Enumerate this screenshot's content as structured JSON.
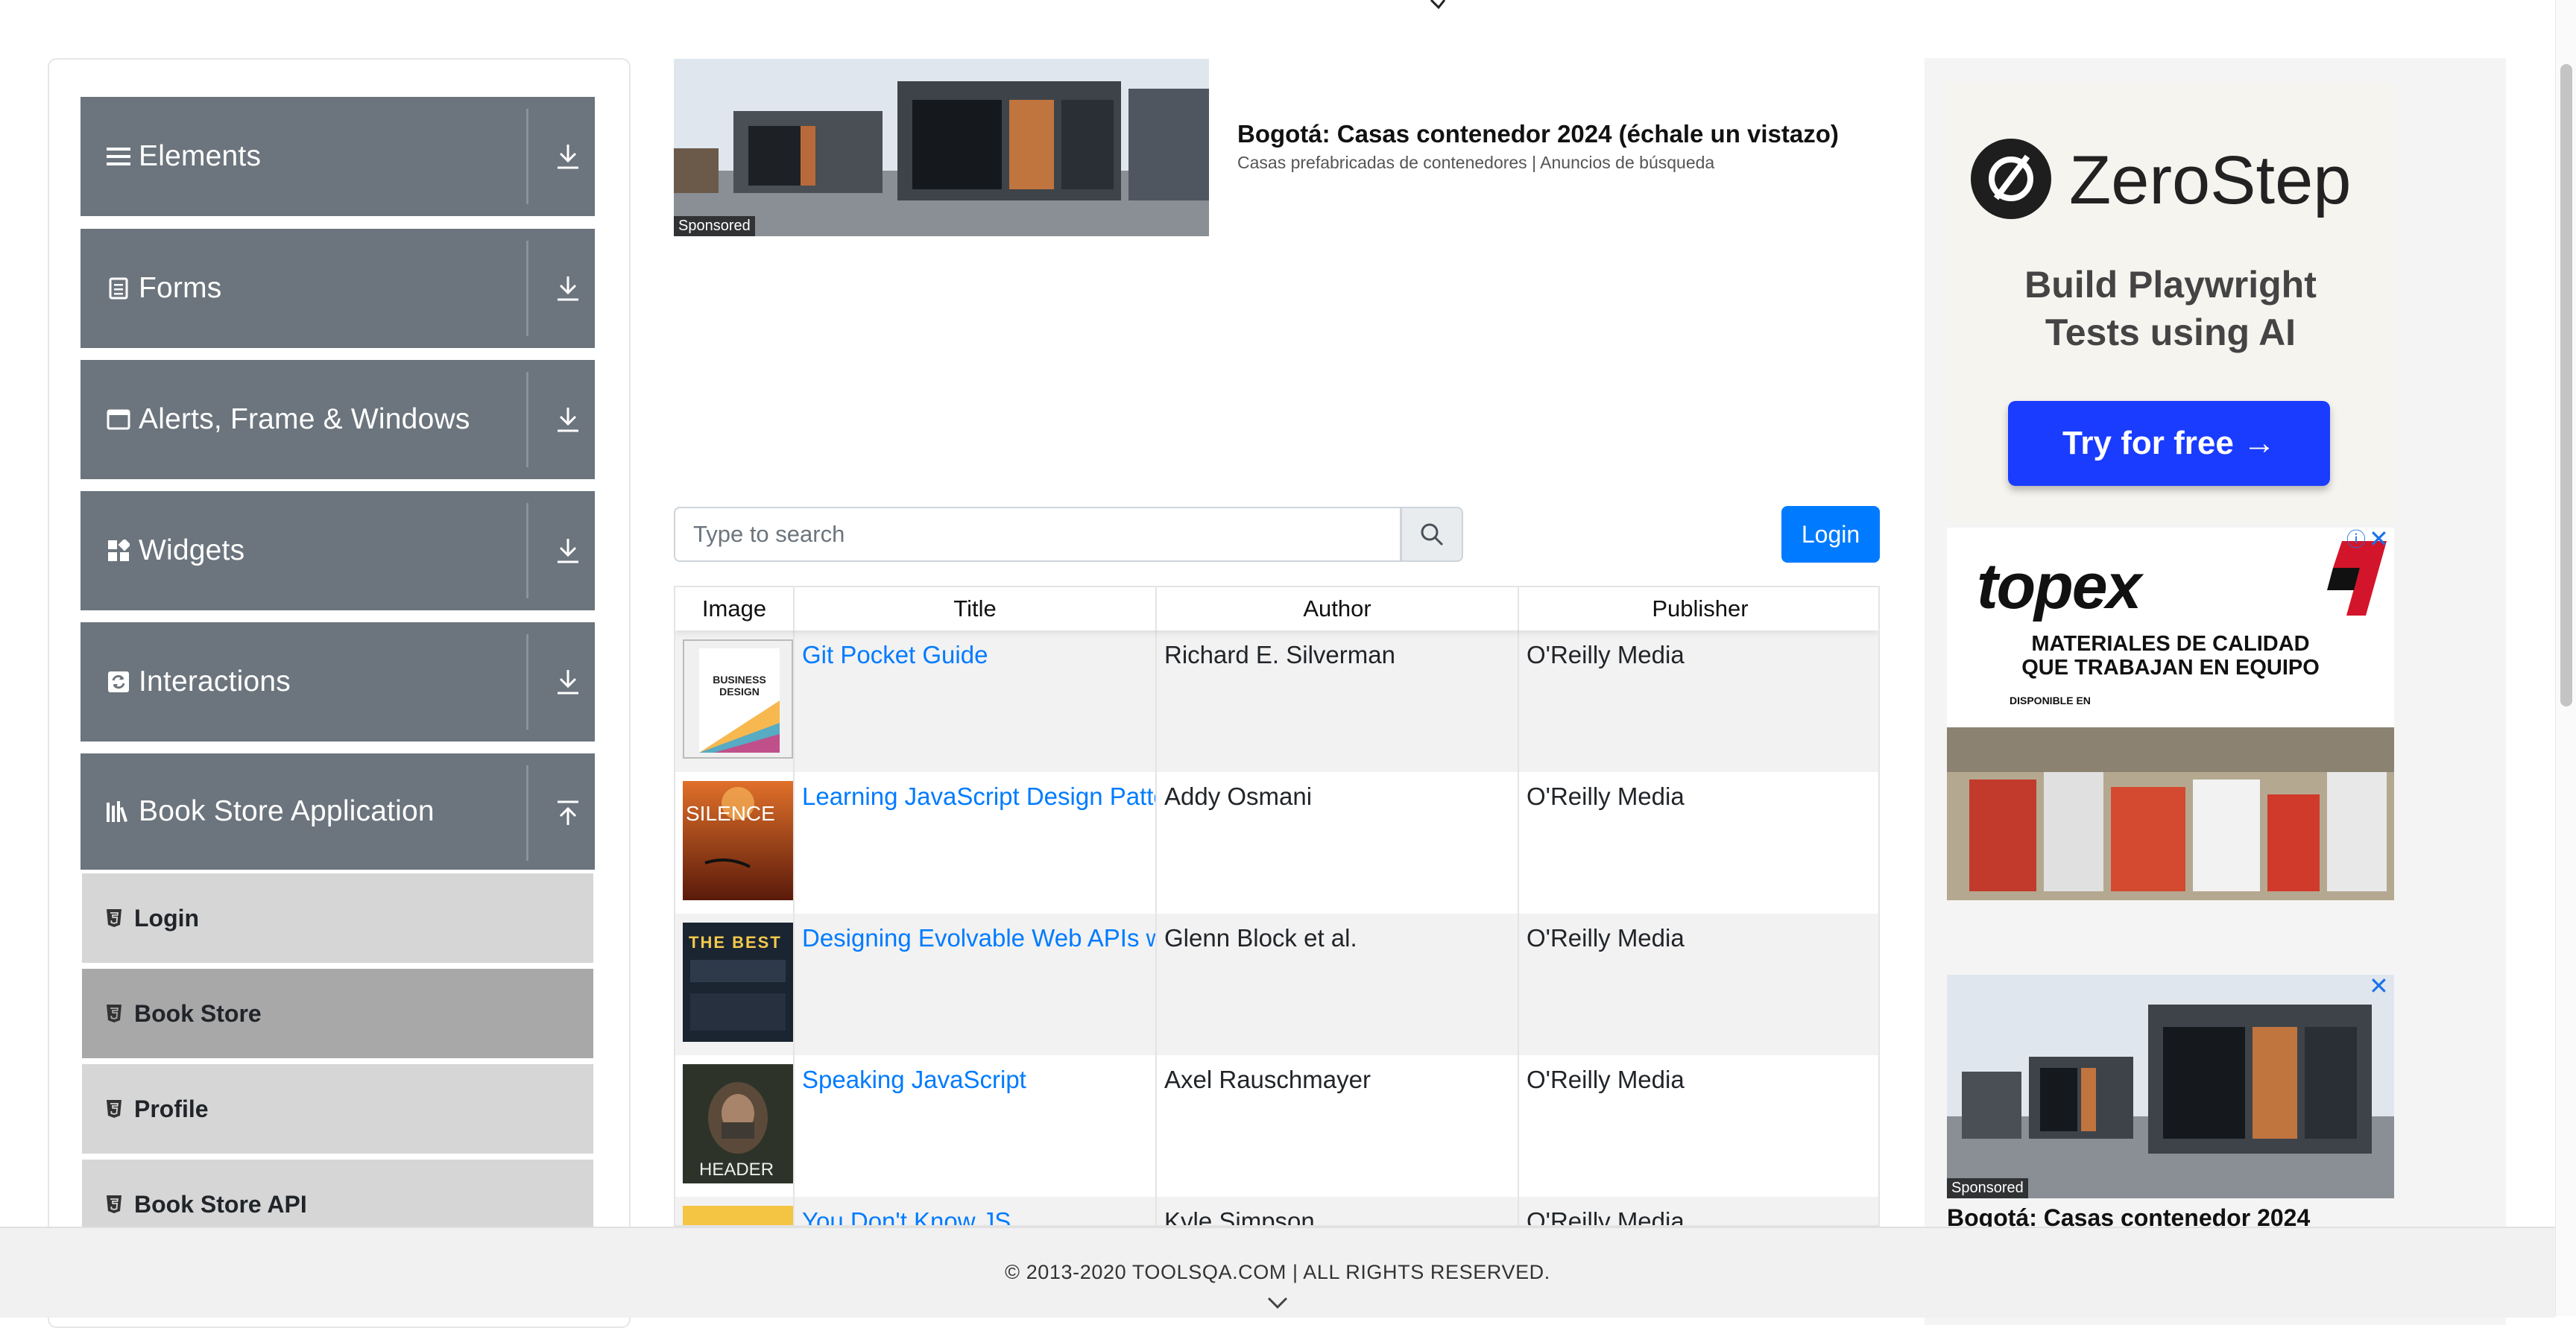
{
  "sidebar": {
    "groups": [
      {
        "label": "Elements",
        "icon": "hamburger-icon",
        "toggle": "download-arrow-icon"
      },
      {
        "label": "Forms",
        "icon": "document-icon",
        "toggle": "download-arrow-icon"
      },
      {
        "label": "Alerts, Frame & Windows",
        "icon": "window-icon",
        "toggle": "download-arrow-icon"
      },
      {
        "label": "Widgets",
        "icon": "grid-icon",
        "toggle": "download-arrow-icon"
      },
      {
        "label": "Interactions",
        "icon": "refresh-icon",
        "toggle": "download-arrow-icon"
      },
      {
        "label": "Book Store Application",
        "icon": "library-icon",
        "toggle": "upload-arrow-icon"
      }
    ],
    "bookstore_items": [
      {
        "label": "Login",
        "icon": "html5-icon",
        "active": false
      },
      {
        "label": "Book Store",
        "icon": "html5-icon",
        "active": true
      },
      {
        "label": "Profile",
        "icon": "html5-icon",
        "active": false
      },
      {
        "label": "Book Store API",
        "icon": "html5-icon",
        "active": false
      }
    ]
  },
  "top_ad": {
    "sponsored": "Sponsored",
    "title": "Bogotá: Casas contenedor 2024 (échale un vistazo)",
    "subtitle": "Casas prefabricadas de contenedores | Anuncios de búsqueda"
  },
  "search": {
    "placeholder": "Type to search",
    "icon": "search-icon"
  },
  "login_button": "Login",
  "table": {
    "headers": [
      "Image",
      "Title",
      "Author",
      "Publisher"
    ],
    "rows": [
      {
        "title": "Git Pocket Guide",
        "author": "Richard E. Silverman",
        "publisher": "O'Reilly Media",
        "cover_text": "BUSINESS DESIGN"
      },
      {
        "title": "Learning JavaScript Design Patterns",
        "author": "Addy Osmani",
        "publisher": "O'Reilly Media",
        "cover_text": "SILENCE"
      },
      {
        "title": "Designing Evolvable Web APIs with ASP.NET",
        "author": "Glenn Block et al.",
        "publisher": "O'Reilly Media",
        "cover_text": "THE BEST"
      },
      {
        "title": "Speaking JavaScript",
        "author": "Axel Rauschmayer",
        "publisher": "O'Reilly Media",
        "cover_text": "HEADER"
      },
      {
        "title": "You Don't Know JS",
        "author": "Kyle Simpson",
        "publisher": "O'Reilly Media",
        "cover_text": ""
      }
    ]
  },
  "right_ads": {
    "zerostep": {
      "brand": "ZeroStep",
      "tagline_1": "Build Playwright",
      "tagline_2": "Tests using AI",
      "button": "Try for free →"
    },
    "topex": {
      "brand": "topex",
      "line_1": "MATERIALES DE CALIDAD",
      "line_2": "QUE TRABAJAN EN EQUIPO",
      "small": "DISPONIBLE EN"
    },
    "bottom": {
      "sponsored": "Sponsored",
      "title": "Bogotá: Casas contenedor 2024"
    },
    "close": "✕",
    "info": "ⓘ"
  },
  "footer": {
    "text": "© 2013-2020 TOOLSQA.COM | ALL RIGHTS RESERVED."
  },
  "colors": {
    "sidebar_header": "#6c757d",
    "menu_item": "#d6d6d6",
    "menu_item_active": "#a8a8a8",
    "link": "#007bff",
    "primary_button": "#007bff",
    "zerostep_button": "#1a3cff"
  }
}
